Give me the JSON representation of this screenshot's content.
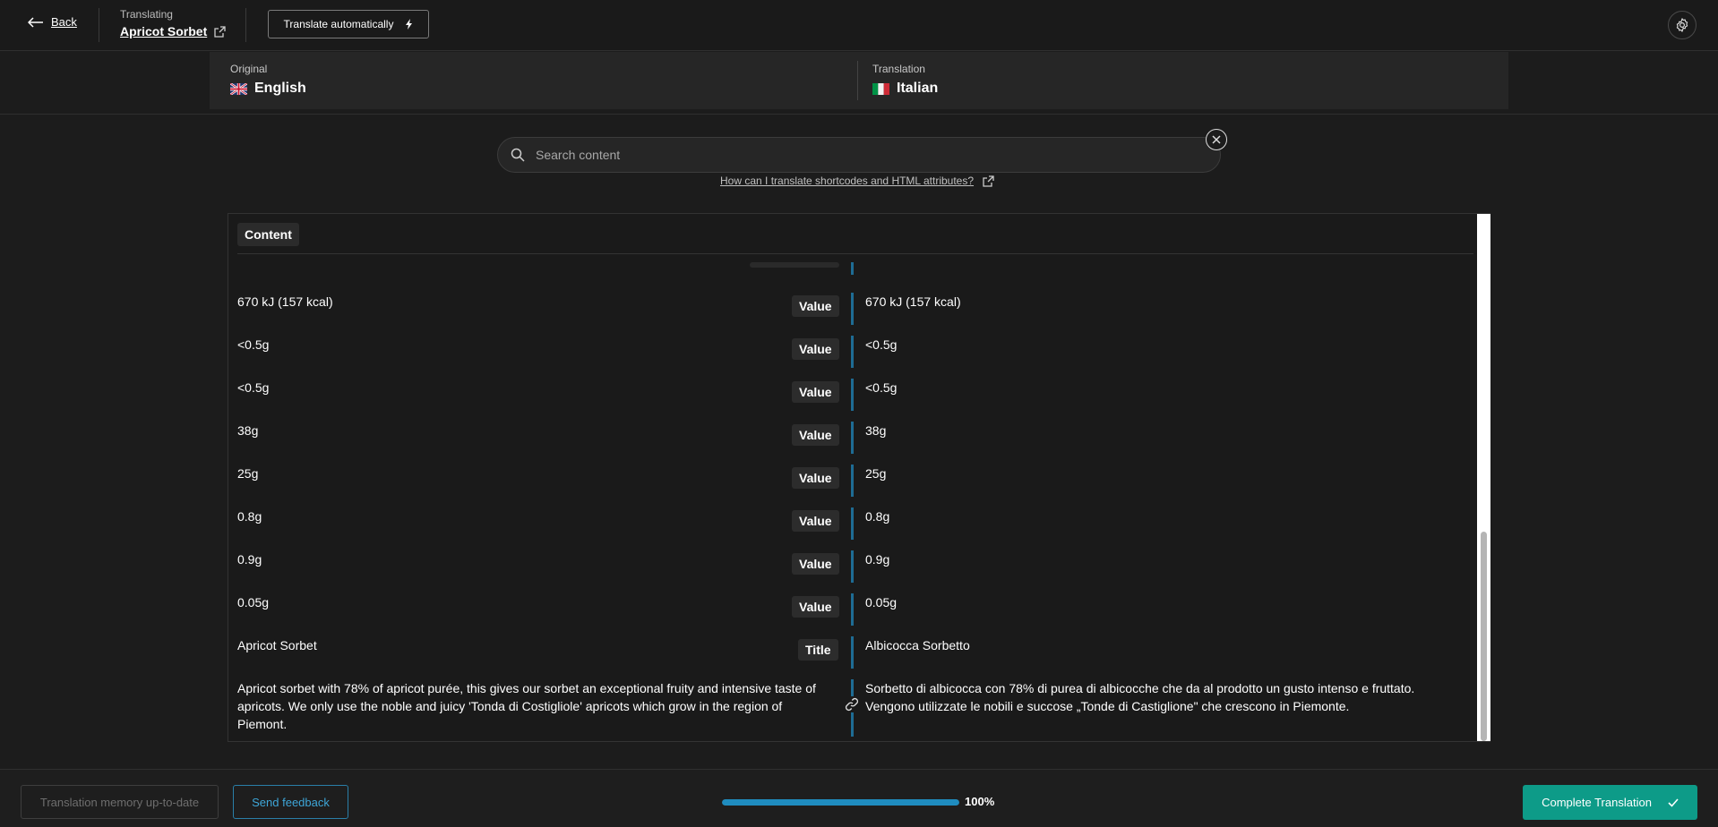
{
  "header": {
    "back_label": "Back",
    "translating_label": "Translating",
    "item_title": "Apricot Sorbet",
    "translate_auto_label": "Translate automatically"
  },
  "languages": {
    "original_label": "Original",
    "original_name": "English",
    "translation_label": "Translation",
    "translation_name": "Italian"
  },
  "search": {
    "placeholder": "Search content",
    "help_link": "How can I translate shortcodes and HTML attributes?"
  },
  "content": {
    "tab_label": "Content",
    "rows": [
      {
        "source": "670 kJ (157 kcal)",
        "field": "Value",
        "target": "670 kJ (157 kcal)"
      },
      {
        "source": "<0.5g",
        "field": "Value",
        "target": "<0.5g"
      },
      {
        "source": "<0.5g",
        "field": "Value",
        "target": "<0.5g"
      },
      {
        "source": "38g",
        "field": "Value",
        "target": "38g"
      },
      {
        "source": "25g",
        "field": "Value",
        "target": "25g"
      },
      {
        "source": "0.8g",
        "field": "Value",
        "target": "0.8g"
      },
      {
        "source": "0.9g",
        "field": "Value",
        "target": "0.9g"
      },
      {
        "source": "0.05g",
        "field": "Value",
        "target": "0.05g"
      },
      {
        "source": "Apricot Sorbet",
        "field": "Title",
        "target": "Albicocca Sorbetto"
      }
    ],
    "description": {
      "source_lines": [
        "Apricot sorbet with 78% of apricot purée, this gives our sorbet an exceptional fruity and intensive taste of",
        "apricots. We only use the noble and juicy 'Tonda di Costigliole' apricots which grow in the region of",
        "Piemont."
      ],
      "target_lines": [
        "Sorbetto di albicocca con 78% di purea di albicocche che da al prodotto un gusto intenso e fruttato.",
        "Vengono utilizzate le nobili e succose „Tonde di Castiglione\" che crescono in Piemonte."
      ]
    }
  },
  "footer": {
    "memory_label": "Translation memory up-to-date",
    "feedback_label": "Send feedback",
    "progress_percent": 100,
    "progress_text": "100%",
    "complete_label": "Complete Translation"
  },
  "colors": {
    "accent": "#0d9b88",
    "link_blue": "#1f8cbf",
    "background": "#1c1c1c"
  }
}
